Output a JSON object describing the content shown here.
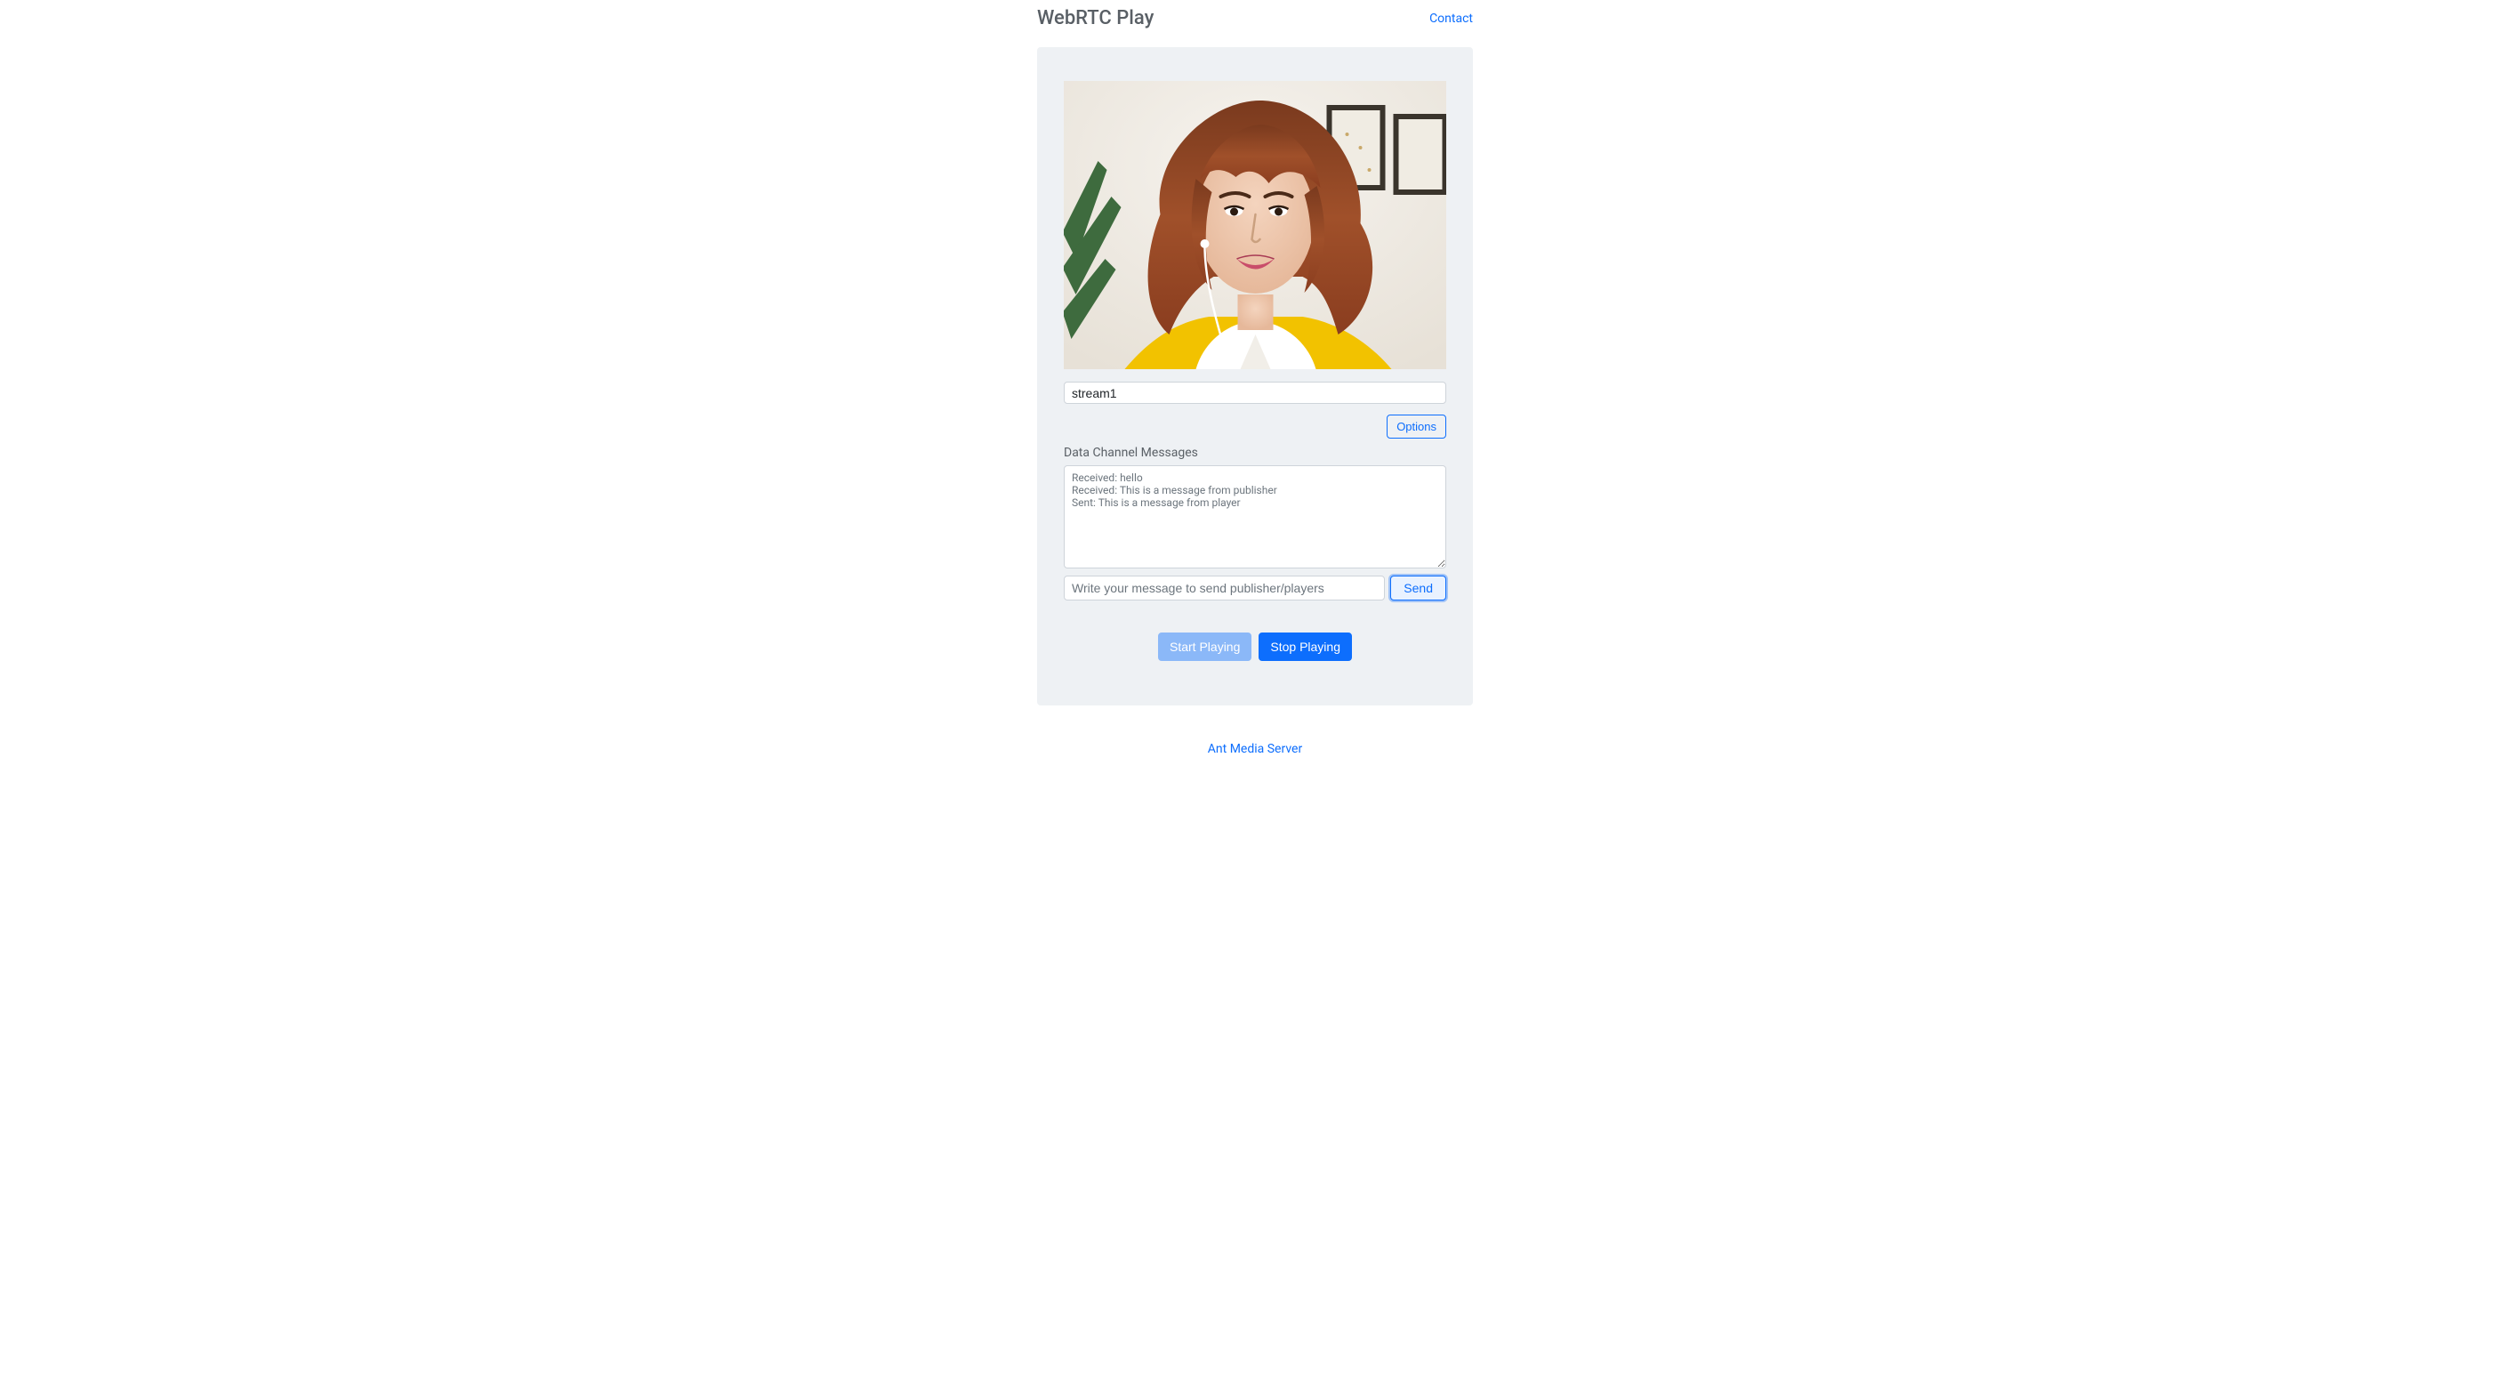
{
  "header": {
    "title": "WebRTC Play",
    "contact_label": "Contact"
  },
  "panel": {
    "stream_id_value": "stream1",
    "options_label": "Options",
    "data_channel_title": "Data Channel Messages",
    "messages_text": "Received: hello\nReceived: This is a message from publisher\nSent: This is a message from player",
    "message_input_placeholder": "Write your message to send publisher/players",
    "send_label": "Send",
    "start_label": "Start Playing",
    "stop_label": "Stop Playing"
  },
  "footer": {
    "link_label": "Ant Media Server"
  },
  "colors": {
    "primary": "#0d6efd",
    "panel_bg": "#eef1f4",
    "muted_text": "#6c757d"
  }
}
